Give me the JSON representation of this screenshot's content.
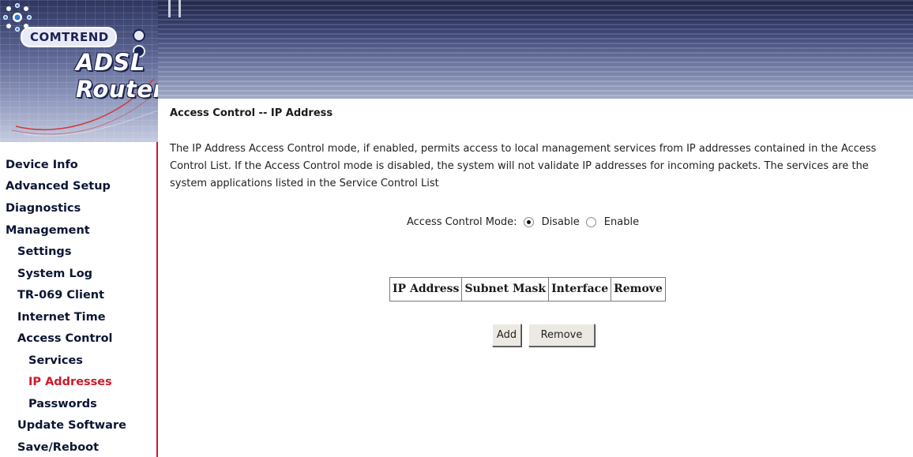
{
  "header": {
    "brand": "COMTREND",
    "product": "ADSL Router"
  },
  "sidebar": {
    "items": [
      {
        "label": "Device Info",
        "level": 0,
        "active": false
      },
      {
        "label": "Advanced Setup",
        "level": 0,
        "active": false
      },
      {
        "label": "Diagnostics",
        "level": 0,
        "active": false
      },
      {
        "label": "Management",
        "level": 0,
        "active": false
      },
      {
        "label": "Settings",
        "level": 1,
        "active": false
      },
      {
        "label": "System Log",
        "level": 1,
        "active": false
      },
      {
        "label": "TR-069 Client",
        "level": 1,
        "active": false
      },
      {
        "label": "Internet Time",
        "level": 1,
        "active": false
      },
      {
        "label": "Access Control",
        "level": 1,
        "active": false
      },
      {
        "label": "Services",
        "level": 2,
        "active": false
      },
      {
        "label": "IP Addresses",
        "level": 2,
        "active": true
      },
      {
        "label": "Passwords",
        "level": 2,
        "active": false
      },
      {
        "label": "Update Software",
        "level": 1,
        "active": false
      },
      {
        "label": "Save/Reboot",
        "level": 1,
        "active": false
      }
    ],
    "active_color": "#cc1a2a"
  },
  "main": {
    "title": "Access Control -- IP Address",
    "description": "The IP Address Access Control mode, if enabled, permits access to local management services from IP addresses contained in the Access Control List. If the Access Control mode is disabled, the system will not validate IP addresses for incoming packets. The services are the system applications listed in the Service Control List",
    "mode_label": "Access Control Mode:",
    "mode_options": [
      {
        "label": "Disable",
        "checked": true
      },
      {
        "label": "Enable",
        "checked": false
      }
    ],
    "table_headers": [
      "IP Address",
      "Subnet Mask",
      "Interface",
      "Remove"
    ],
    "add_button": "Add",
    "remove_button": "Remove"
  }
}
